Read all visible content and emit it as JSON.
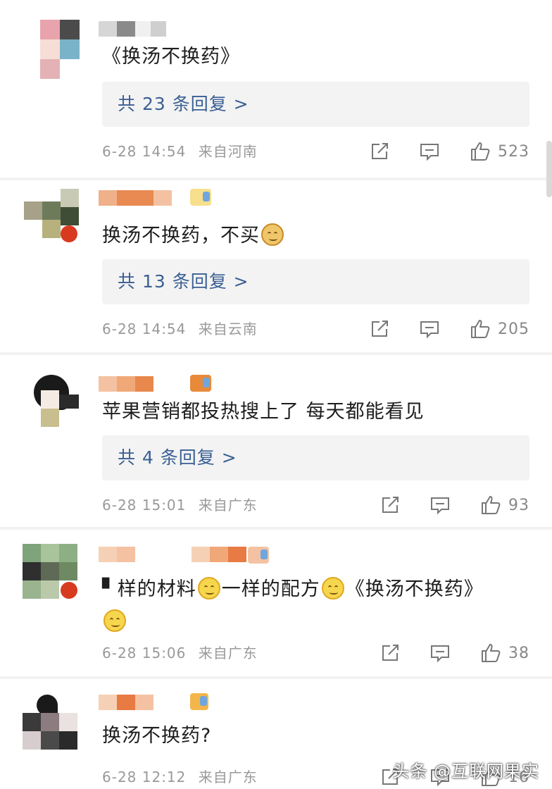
{
  "comments": [
    {
      "text": "《换汤不换药》",
      "replies_label": "共 23 条回复 >",
      "date": "6-28 14:54",
      "location": "来自河南",
      "likes": "523"
    },
    {
      "text": "换汤不换药，不买",
      "replies_label": "共 13 条回复 >",
      "date": "6-28 14:54",
      "location": "来自云南",
      "likes": "205"
    },
    {
      "text": "苹果营销都投热搜上了 每天都能看见",
      "replies_label": "共 4 条回复 >",
      "date": "6-28 15:01",
      "location": "来自广东",
      "likes": "93"
    },
    {
      "text_part1": "▘样的材料",
      "text_part2": "一样的配方",
      "text_part3": "《换汤不换药》",
      "date": "6-28 15:06",
      "location": "来自广东",
      "likes": "38"
    },
    {
      "text": "换汤不换药?",
      "date": "6-28 12:12",
      "location": "来自广东",
      "likes": "16"
    }
  ],
  "icons": {
    "share": "share-icon",
    "comment": "comment-icon",
    "like": "thumbs-up-icon"
  },
  "colors": {
    "reply_link": "#3a5f93",
    "meta_text": "#999999",
    "background": "#f2f2f2"
  },
  "watermark": "头条 @互联网果实"
}
